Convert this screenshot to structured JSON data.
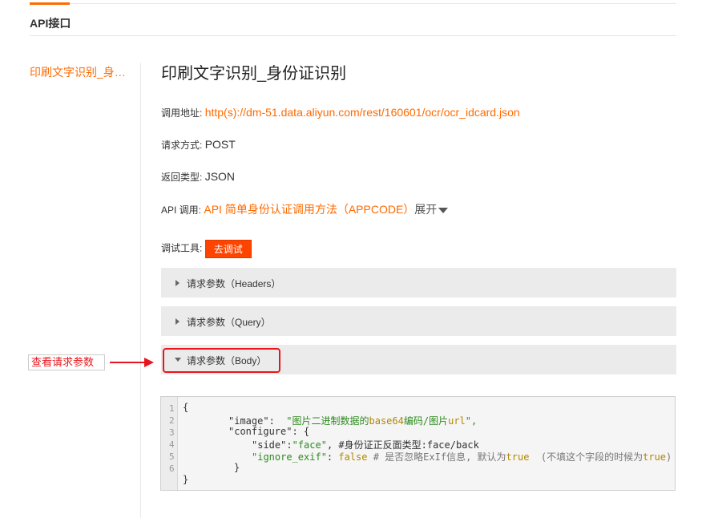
{
  "header": {
    "section_title": "API接口"
  },
  "sidebar": {
    "item_label": "印刷文字识别_身份证识别"
  },
  "main": {
    "title": "印刷文字识别_身份证识别",
    "fields": {
      "call_address_label": "调用地址:",
      "call_address_value": "http(s)://dm-51.data.aliyun.com/rest/160601/ocr/ocr_idcard.json",
      "method_label": "请求方式:",
      "method_value": "POST",
      "return_type_label": "返回类型:",
      "return_type_value": "JSON",
      "api_call_label": "API 调用:",
      "api_call_link": "API 简单身份认证调用方法（APPCODE）",
      "expand_label": "展开",
      "debug_tool_label": "调试工具:",
      "debug_button": "去调试"
    },
    "params": [
      {
        "label": "请求参数（Headers）",
        "expanded": false
      },
      {
        "label": "请求参数（Query）",
        "expanded": false
      },
      {
        "label": "请求参数（Body）",
        "expanded": true
      }
    ],
    "code": {
      "line_numbers": [
        "1",
        "2",
        "3",
        "4",
        "5",
        "6"
      ],
      "l1": "{",
      "l2_key": "\"image\"",
      "l2_colon": ":  ",
      "l2_val_a": "\"图片二进制数据的",
      "l2_val_b": "base64",
      "l2_val_c": "编码/图片",
      "l2_val_d": "url",
      "l2_val_e": "\",",
      "l3_key": "\"configure\"",
      "l3_rest": ": {",
      "l4_key": "\"side\"",
      "l4_colon": ":",
      "l4_val": "\"face\"",
      "l4_comment": ", #身份证正反面类型:face/back",
      "l5_key": "\"ignore_exif\"",
      "l5_colon": ": ",
      "l5_val": "false",
      "l5_comment_a": " # 是否忽略ExIf信息, 默认为",
      "l5_true1": "true",
      "l5_comment_b": "  (不填这个字段的时候为",
      "l5_true2": "true",
      "l5_comment_c": ")",
      "l6": "}",
      "l7": "}"
    }
  },
  "annotation": {
    "label": "查看请求参数"
  },
  "colors": {
    "accent": "#ff6a00",
    "annotation_red": "#e8161c",
    "debug_button_bg": "#ff4400"
  }
}
